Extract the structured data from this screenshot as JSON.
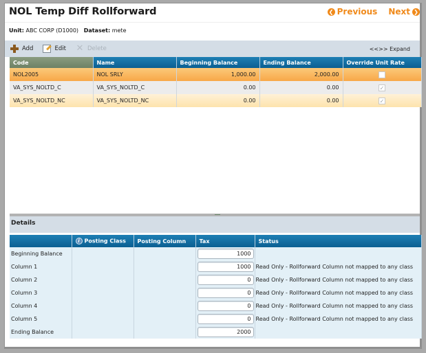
{
  "header": {
    "title": "NOL Temp Diff Rollforward",
    "previous_label": "Previous",
    "next_label": "Next",
    "unit_label": "Unit:",
    "unit_value": "ABC CORP (D1000)",
    "dataset_label": "Dataset:",
    "dataset_value": "mete"
  },
  "toolbar": {
    "add_label": "Add",
    "edit_label": "Edit",
    "delete_label": "Delete",
    "expand_label": "<<>> Expand"
  },
  "grid": {
    "columns": [
      "Code",
      "Name",
      "Beginning Balance",
      "Ending Balance",
      "Override Unit Rate"
    ],
    "rows": [
      {
        "code": "NOL2005",
        "name": "NOL SRLY",
        "beginning": "1,000.00",
        "ending": "2,000.00",
        "override": false,
        "override_mark": "",
        "state": "selected"
      },
      {
        "code": "VA_SYS_NOLTD_C",
        "name": "VA_SYS_NOLTD_C",
        "beginning": "0.00",
        "ending": "0.00",
        "override": true,
        "override_mark": "✓",
        "state": "disabled"
      },
      {
        "code": "VA_SYS_NOLTD_NC",
        "name": "VA_SYS_NOLTD_NC",
        "beginning": "0.00",
        "ending": "0.00",
        "override": true,
        "override_mark": "✓",
        "state": "disabled"
      }
    ]
  },
  "details": {
    "title": "Details",
    "columns": [
      "",
      "Posting Class",
      "Posting Column",
      "Tax",
      "Status"
    ],
    "info_icon_glyph": "i",
    "rows": [
      {
        "label": "Beginning Balance",
        "posting_class": "",
        "posting_column": "",
        "tax": "1000",
        "status": ""
      },
      {
        "label": "Column 1",
        "posting_class": "",
        "posting_column": "",
        "tax": "1000",
        "status": "Read Only - Rollforward Column not mapped to any class"
      },
      {
        "label": "Column 2",
        "posting_class": "",
        "posting_column": "",
        "tax": "0",
        "status": "Read Only - Rollforward Column not mapped to any class"
      },
      {
        "label": "Column 3",
        "posting_class": "",
        "posting_column": "",
        "tax": "0",
        "status": "Read Only - Rollforward Column not mapped to any class"
      },
      {
        "label": "Column 4",
        "posting_class": "",
        "posting_column": "",
        "tax": "0",
        "status": "Read Only - Rollforward Column not mapped to any class"
      },
      {
        "label": "Column 5",
        "posting_class": "",
        "posting_column": "",
        "tax": "0",
        "status": "Read Only - Rollforward Column not mapped to any class"
      },
      {
        "label": "Ending Balance",
        "posting_class": "",
        "posting_column": "",
        "tax": "2000",
        "status": ""
      }
    ]
  },
  "icons": {
    "previous": "chevron-left-circle",
    "next": "chevron-right-circle",
    "add": "plus",
    "edit": "edit-pencil",
    "delete": "x",
    "info": "info-circle",
    "checkbox": "checkbox"
  },
  "colors": {
    "accent_orange": "#f08a1b",
    "header_blue": "#0b5f92",
    "selected_row": "#f8a848",
    "alt_row": "#fde3ac",
    "toolbar_bg": "#d4dde6",
    "details_bg": "#e3f0f7"
  }
}
